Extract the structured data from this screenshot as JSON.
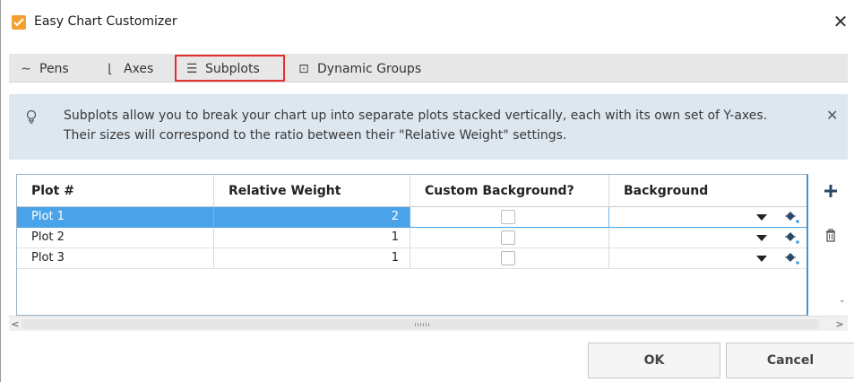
{
  "window": {
    "title": "Easy Chart Customizer",
    "close_glyph": "✕"
  },
  "tabs": [
    {
      "label": "Pens",
      "icon": "pens-wave-icon",
      "glyph": "∼"
    },
    {
      "label": "Axes",
      "icon": "axes-icon",
      "glyph": "⌊"
    },
    {
      "label": "Subplots",
      "icon": "subplots-icon",
      "glyph": "☰",
      "active": true
    },
    {
      "label": "Dynamic Groups",
      "icon": "dynamic-groups-icon",
      "glyph": "⊡"
    }
  ],
  "info": {
    "text": "Subplots allow you to break your chart up into separate plots stacked vertically, each with its own set of Y-axes. Their sizes will correspond to the ratio between their \"Relative Weight\" settings.",
    "close_glyph": "✕"
  },
  "table": {
    "columns": [
      "Plot #",
      "Relative Weight",
      "Custom Background?",
      "Background"
    ],
    "rows": [
      {
        "plot": "Plot 1",
        "weight": "2",
        "custom_bg": false,
        "background": "",
        "selected": true
      },
      {
        "plot": "Plot 2",
        "weight": "1",
        "custom_bg": false,
        "background": "",
        "selected": false
      },
      {
        "plot": "Plot 3",
        "weight": "1",
        "custom_bg": false,
        "background": "",
        "selected": false
      }
    ]
  },
  "scrollbar": {
    "left_glyph": "<",
    "right_glyph": ">"
  },
  "side_tools": {
    "add_glyph": "+",
    "vs_glyph": "⌄"
  },
  "footer": {
    "ok_label": "OK",
    "cancel_label": "Cancel"
  },
  "colors": {
    "selection": "#4aa3e8",
    "info_bg": "#dde7ef",
    "highlight": "#e0312c",
    "app_icon": "#f0a030"
  }
}
